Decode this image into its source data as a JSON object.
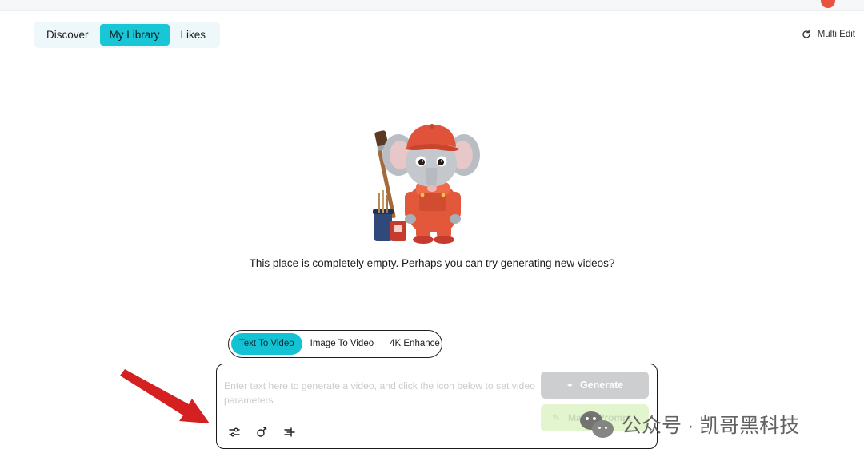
{
  "nav": {
    "tabs": [
      {
        "label": "Discover",
        "active": false
      },
      {
        "label": "My Library",
        "active": true
      },
      {
        "label": "Likes",
        "active": false
      }
    ]
  },
  "toolbar": {
    "multi_edit_label": "Multi Edit",
    "multi_edit_icon": "refresh-icon"
  },
  "empty_state": {
    "illustration": "elephant-painter-mascot",
    "message": "This place is completely empty. Perhaps you can try generating new videos?"
  },
  "modes": [
    {
      "label": "Text To Video",
      "active": true
    },
    {
      "label": "Image To Video",
      "active": false
    },
    {
      "label": "4K Enhance",
      "active": false
    }
  ],
  "composer": {
    "placeholder": "Enter text here to generate a video, and click the icon below to set video parameters",
    "generate_label": "Generate",
    "magic_label": "Magic Prompt",
    "tools": [
      "sliders-icon",
      "camera-motion-icon",
      "filter-icon"
    ]
  },
  "annotation": {
    "arrow_color": "#d42020"
  },
  "watermark": {
    "text": "公众号 · 凯哥黑科技",
    "icon": "wechat-icon"
  },
  "colors": {
    "accent": "#19c6d6",
    "generate_disabled": "#cdced0",
    "magic_bg": "#e3f5ce"
  }
}
